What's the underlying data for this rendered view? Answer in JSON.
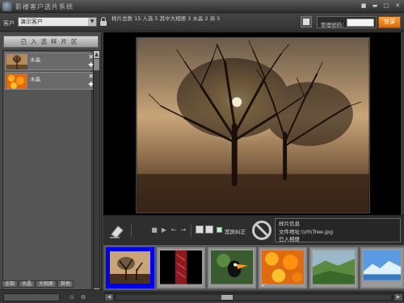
{
  "window": {
    "title": "影楼客户选片系统"
  },
  "toolbar": {
    "customer_label": "客户",
    "customer_select": "演示客户",
    "stats": "样片总数 15  入选 5  其中大相册 3  水晶 2  另 5",
    "admin_label": "管理密码：",
    "login_label": "登录"
  },
  "left_panel": {
    "header": "已入选样片区",
    "items": [
      {
        "label": "水晶"
      },
      {
        "label": "水晶"
      }
    ],
    "tabs": [
      "全部",
      "水晶",
      "大相册",
      "其他"
    ]
  },
  "controls": {
    "wide_label": "宽屏纠正",
    "info_title": "样片信息",
    "info_file": "文件地址:\\\\rh\\Tree.jpg",
    "info_status": "已入相册"
  },
  "thumbnails": [
    {
      "icon": "tree-photo",
      "active": true
    },
    {
      "icon": "red-pattern-photo",
      "active": false
    },
    {
      "icon": "toucan-photo",
      "active": false
    },
    {
      "icon": "orange-flowers-photo",
      "active": false,
      "checked": true
    },
    {
      "icon": "green-valley-photo",
      "active": false
    },
    {
      "icon": "blue-ice-photo",
      "active": false
    }
  ],
  "colors": {
    "accent": "#0000f0",
    "login": "#e8821c"
  }
}
